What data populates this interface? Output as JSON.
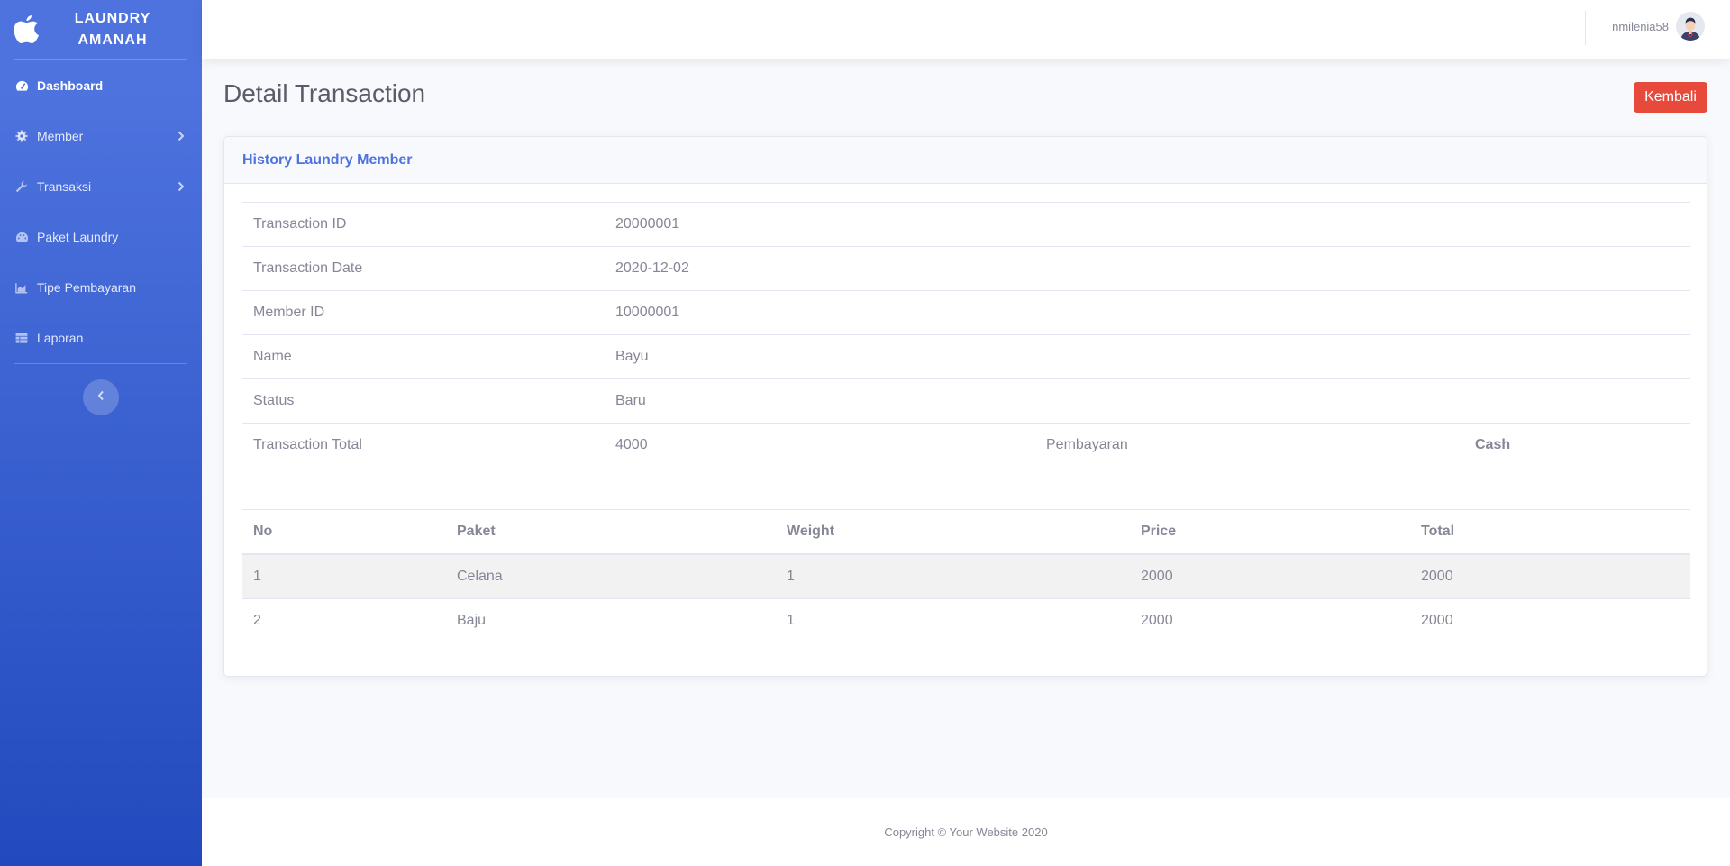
{
  "brand": {
    "line1": "LAUNDRY",
    "line2": "AMANAH",
    "logo_icon": "apple-icon"
  },
  "sidebar": {
    "items": [
      {
        "label": "Dashboard",
        "icon": "tachometer-icon",
        "active": true
      },
      {
        "label": "Member",
        "icon": "cog-icon",
        "has_submenu": true
      },
      {
        "label": "Transaksi",
        "icon": "wrench-icon",
        "has_submenu": true
      },
      {
        "label": "Paket Laundry",
        "icon": "palette-icon"
      },
      {
        "label": "Tipe Pembayaran",
        "icon": "chart-area-icon"
      },
      {
        "label": "Laporan",
        "icon": "table-icon"
      }
    ]
  },
  "topbar": {
    "username": "nmilenia58"
  },
  "page": {
    "title": "Detail Transaction",
    "back_button": "Kembali"
  },
  "card": {
    "header": "History Laundry Member",
    "info": [
      {
        "label": "Transaction ID",
        "value": "20000001"
      },
      {
        "label": "Transaction Date",
        "value": "2020-12-02"
      },
      {
        "label": "Member ID",
        "value": "10000001"
      },
      {
        "label": "Name",
        "value": "Bayu"
      },
      {
        "label": "Status",
        "value": "Baru"
      }
    ],
    "total": {
      "label": "Transaction Total",
      "value": "4000",
      "payment_label": "Pembayaran",
      "payment_value": "Cash"
    },
    "items_header": {
      "no": "No",
      "paket": "Paket",
      "weight": "Weight",
      "price": "Price",
      "total": "Total"
    },
    "items": [
      {
        "no": "1",
        "paket": "Celana",
        "weight": "1",
        "price": "2000",
        "total": "2000"
      },
      {
        "no": "2",
        "paket": "Baju",
        "weight": "1",
        "price": "2000",
        "total": "2000"
      }
    ]
  },
  "footer": {
    "text": "Copyright © Your Website 2020"
  },
  "colors": {
    "primary": "#4e73df",
    "danger": "#e74a3b",
    "text": "#858796"
  }
}
